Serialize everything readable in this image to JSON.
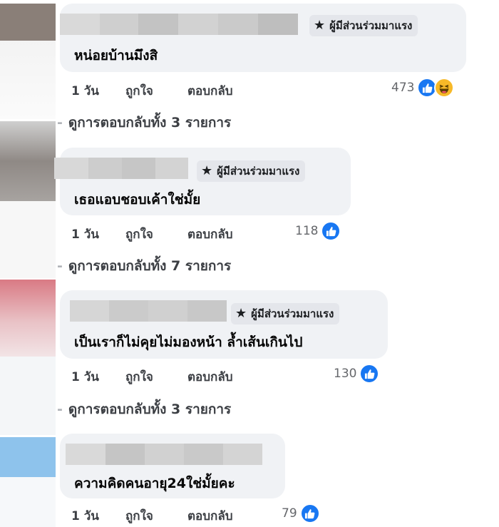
{
  "badge_label": "ผู้มีส่วนร่วมมาแรง",
  "actions": {
    "time": "1 วัน",
    "like": "ถูกใจ",
    "reply": "ตอบกลับ"
  },
  "colors": {
    "bubble": "#f0f2f5",
    "like_blue": "#1877f2",
    "haha_yellow": "#f7b928"
  },
  "comments": [
    {
      "text": "หน่อยบ้านมึงสิ",
      "reactions": "473",
      "reaction_icons": [
        "like-icon",
        "haha-icon"
      ],
      "view_replies": "ดูการตอบกลับทั้ง 3 รายการ"
    },
    {
      "text": "เธอแอบชอบเค้าใช่มั้ย",
      "reactions": "118",
      "reaction_icons": [
        "like-icon"
      ],
      "view_replies": "ดูการตอบกลับทั้ง 7 รายการ"
    },
    {
      "text": "เป็นเราก็ไม่คุยไม่มองหน้า ล้ำเส้นเกินไป",
      "reactions": "130",
      "reaction_icons": [
        "like-icon"
      ],
      "view_replies": "ดูการตอบกลับทั้ง 3 รายการ"
    },
    {
      "text": "ความคิดคนอายุ24ใช่มั้ยคะ",
      "reactions": "79",
      "reaction_icons": [
        "like-icon"
      ]
    }
  ]
}
